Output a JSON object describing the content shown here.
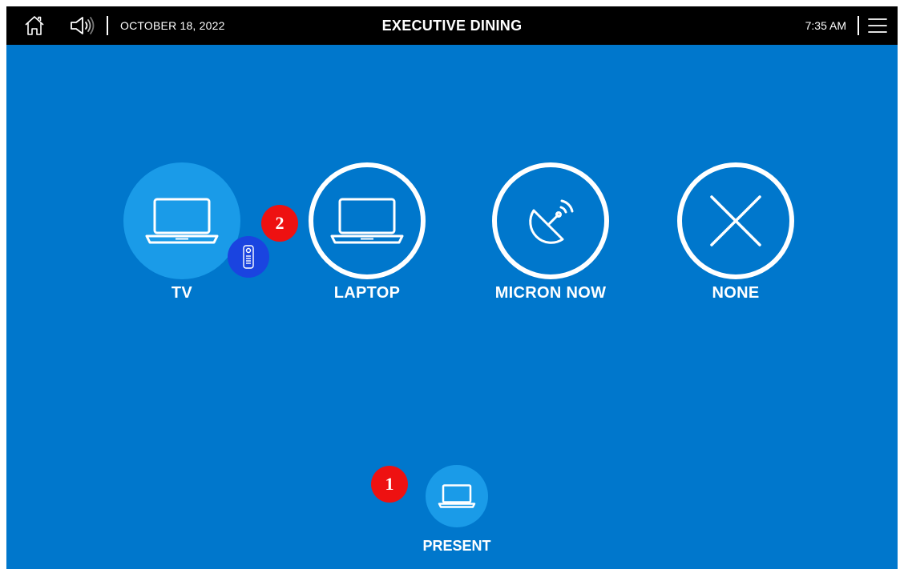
{
  "header": {
    "date": "OCTOBER 18, 2022",
    "room_title": "EXECUTIVE DINING",
    "time": "7:35 AM",
    "icons": [
      "home-icon",
      "volume-icon",
      "menu-icon"
    ]
  },
  "sources": [
    {
      "label": "TV",
      "icon": "laptop-icon",
      "selected": true
    },
    {
      "label": "LAPTOP",
      "icon": "laptop-icon",
      "selected": false
    },
    {
      "label": "MICRON NOW",
      "icon": "satellite-dish-icon",
      "selected": false
    },
    {
      "label": "NONE",
      "icon": "close-icon",
      "selected": false
    }
  ],
  "remote": {
    "icon": "remote-control-icon"
  },
  "markers": [
    "1",
    "2"
  ],
  "present": {
    "label": "PRESENT",
    "icon": "laptop-icon"
  },
  "colors": {
    "background": "#0077cc",
    "topbar": "#000000",
    "active_source": "#1a9be8",
    "remote_button": "#1a44e0",
    "marker": "#ee1111",
    "text": "#ffffff"
  }
}
